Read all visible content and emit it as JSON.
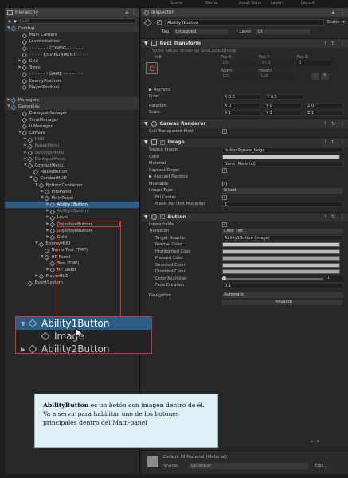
{
  "window_tabs": [
    "Scene",
    "Game",
    "Asset Store",
    "Layers",
    "Layout"
  ],
  "hierarchy": {
    "tab_label": "Hierarchy",
    "search_placeholder": "All",
    "rows": [
      {
        "label": "Combat",
        "indent": 0,
        "arrow": "▼",
        "style": "scene",
        "icon": "scene"
      },
      {
        "label": "Main Camera",
        "indent": 2,
        "arrow": "",
        "style": "",
        "icon": "cube"
      },
      {
        "label": "LevelInitializer",
        "indent": 2,
        "arrow": "",
        "style": "",
        "icon": "cube"
      },
      {
        "label": "- - - - - - - CONFIG - - - - - -",
        "indent": 2,
        "arrow": "",
        "style": "",
        "icon": "cube"
      },
      {
        "label": "- - - - - ENVIRONMENT - - - -",
        "indent": 2,
        "arrow": "",
        "style": "",
        "icon": "cube"
      },
      {
        "label": "Grid",
        "indent": 2,
        "arrow": "▶",
        "style": "",
        "icon": "cube"
      },
      {
        "label": "Trees",
        "indent": 2,
        "arrow": "▶",
        "style": "",
        "icon": "cube"
      },
      {
        "label": "- - - - - - - GAME - - - - - - -",
        "indent": 2,
        "arrow": "",
        "style": "",
        "icon": "cube"
      },
      {
        "label": "EnemyPosition",
        "indent": 2,
        "arrow": "",
        "style": "",
        "icon": "cube"
      },
      {
        "label": "PlayerPosition",
        "indent": 2,
        "arrow": "",
        "style": "",
        "icon": "cube"
      },
      {
        "label": "",
        "indent": 0,
        "arrow": "",
        "style": "",
        "icon": ""
      },
      {
        "label": "Managers",
        "indent": 0,
        "arrow": "▶",
        "style": "scene",
        "icon": "scene"
      },
      {
        "label": "Gameplay",
        "indent": 0,
        "arrow": "▼",
        "style": "scene",
        "icon": "scene"
      },
      {
        "label": "DialogueManager",
        "indent": 2,
        "arrow": "",
        "style": "",
        "icon": "cube"
      },
      {
        "label": "TimeManager",
        "indent": 2,
        "arrow": "",
        "style": "",
        "icon": "cube"
      },
      {
        "label": "UIManager",
        "indent": 2,
        "arrow": "",
        "style": "",
        "icon": "cube"
      },
      {
        "label": "Canvas",
        "indent": 2,
        "arrow": "▼",
        "style": "",
        "icon": "cube"
      },
      {
        "label": "HUD",
        "indent": 3,
        "arrow": "▶",
        "style": "dim",
        "icon": "cube"
      },
      {
        "label": "PauseMenu",
        "indent": 3,
        "arrow": "▶",
        "style": "dim",
        "icon": "cube"
      },
      {
        "label": "SettingsMenu",
        "indent": 3,
        "arrow": "▶",
        "style": "dim",
        "icon": "cube"
      },
      {
        "label": "DialogueMenu",
        "indent": 3,
        "arrow": "▶",
        "style": "dim",
        "icon": "cube"
      },
      {
        "label": "CombatMenu",
        "indent": 3,
        "arrow": "▼",
        "style": "",
        "icon": "cube"
      },
      {
        "label": "PauseButton",
        "indent": 4,
        "arrow": "",
        "style": "",
        "icon": "cube"
      },
      {
        "label": "CombatHUD",
        "indent": 4,
        "arrow": "▼",
        "style": "",
        "icon": "cube"
      },
      {
        "label": "BottomContainer",
        "indent": 5,
        "arrow": "▼",
        "style": "",
        "icon": "cube"
      },
      {
        "label": "InfoPanel",
        "indent": 6,
        "arrow": "▶",
        "style": "",
        "icon": "cube"
      },
      {
        "label": "MainPanel",
        "indent": 6,
        "arrow": "▼",
        "style": "",
        "icon": "cube"
      },
      {
        "label": "Ability1Button",
        "indent": 7,
        "arrow": "▶",
        "style": "sel",
        "icon": "cube"
      },
      {
        "label": "Ability2Button",
        "indent": 7,
        "arrow": "▶",
        "style": "dim",
        "icon": "cube"
      },
      {
        "label": "Level",
        "indent": 7,
        "arrow": "▶",
        "style": "",
        "icon": "cube"
      },
      {
        "label": "ObjectiveButton",
        "indent": 7,
        "arrow": "▶",
        "style": "",
        "icon": "cube"
      },
      {
        "label": "ObjectiveButton",
        "indent": 7,
        "arrow": "▶",
        "style": "",
        "icon": "cube"
      },
      {
        "label": "Gold",
        "indent": 7,
        "arrow": "▶",
        "style": "",
        "icon": "cube"
      },
      {
        "label": "EnemyHUD",
        "indent": 5,
        "arrow": "▼",
        "style": "",
        "icon": "cube"
      },
      {
        "label": "Name Text (TMP)",
        "indent": 6,
        "arrow": "",
        "style": "",
        "icon": "cube"
      },
      {
        "label": "HP Panel",
        "indent": 6,
        "arrow": "▼",
        "style": "",
        "icon": "cube"
      },
      {
        "label": "Text (TMP)",
        "indent": 7,
        "arrow": "",
        "style": "",
        "icon": "cube"
      },
      {
        "label": "HP Slider",
        "indent": 7,
        "arrow": "▶",
        "style": "",
        "icon": "cube"
      },
      {
        "label": "PlayerHUD",
        "indent": 5,
        "arrow": "▶",
        "style": "",
        "icon": "cube"
      },
      {
        "label": "EventSystem",
        "indent": 3,
        "arrow": "",
        "style": "",
        "icon": "cube"
      }
    ]
  },
  "zoom": {
    "rows": [
      {
        "label": "Ability1Button",
        "arrow": "▼",
        "style": "sel",
        "indent": 0
      },
      {
        "label": "Image",
        "arrow": "",
        "style": "",
        "indent": 1
      },
      {
        "label": "Ability2Button",
        "arrow": "▶",
        "style": "",
        "indent": 0
      }
    ]
  },
  "inspector": {
    "tab_label": "Inspector",
    "object_name": "Ability1Button",
    "static_label": "Static",
    "tag_label": "Tag",
    "tag_value": "Untagged",
    "layer_label": "Layer",
    "layer_value": "UI",
    "rect_transform": {
      "title": "Rect Transform",
      "note": "Some values driven by GridLayoutGroup.",
      "anchor_label": "left",
      "pos_x_label": "Pos X",
      "pos_y_label": "Pos Y",
      "pos_z_label": "Pos Z",
      "pos_x": "100",
      "pos_y": "-97.5",
      "pos_z": "0",
      "width_label": "Width",
      "height_label": "Height",
      "width": "100",
      "height": "125",
      "anchors_label": "Anchors",
      "pivot_label": "Pivot",
      "pivot_x": "X 0.5",
      "pivot_y": "Y 0.5",
      "rotation_label": "Rotation",
      "rot_x": "X 0",
      "rot_y": "Y 0",
      "rot_z": "Z 0",
      "scale_label": "Scale",
      "scale_x": "X 1",
      "scale_y": "Y 1",
      "scale_z": "Z 1"
    },
    "canvas_renderer": {
      "title": "Canvas Renderer",
      "cull_label": "Cull Transparent Mesh",
      "cull_value": "✓"
    },
    "image": {
      "title": "Image",
      "source_label": "Source Image",
      "source_value": "buttonSquare_beige",
      "color_label": "Color",
      "material_label": "Material",
      "material_value": "None (Material)",
      "raycast_target_label": "Raycast Target",
      "raycast_padding_label": "Raycast Padding",
      "maskable_label": "Maskable",
      "image_type_label": "Image Type",
      "image_type_value": "Sliced",
      "fill_center_label": "Fill Center",
      "ppu_label": "Pixels Per Unit Multiplier",
      "ppu_value": "1"
    },
    "button": {
      "title": "Button",
      "interactable_label": "Interactable",
      "transition_label": "Transition",
      "transition_value": "Color Tint",
      "target_label": "Target Graphic",
      "target_value": "Ability1Button (Image)",
      "normal_label": "Normal Color",
      "highlighted_label": "Highlighted Color",
      "pressed_label": "Pressed Color",
      "selected_label": "Selected Color",
      "disabled_label": "Disabled Color",
      "multiplier_label": "Color Multiplier",
      "multiplier_value": "1",
      "fade_label": "Fade Duration",
      "fade_value": "0.1",
      "navigation_label": "Navigation",
      "navigation_value": "Automatic",
      "visualize_label": "Visualize"
    },
    "material_footer": {
      "name": "Default UI Material (Material)",
      "shader_label": "Shader",
      "shader_value": "UI/Default",
      "edit_label": "Edit..."
    }
  },
  "note": {
    "bold": "AbilityButton",
    "text": " es un botón con imagen dentro de él. Va a servir para habilitar uno de los botones principales dentro del Main-panel"
  },
  "colors": {
    "selection": "#2c5d87",
    "highlight_border": "#d33333",
    "note_bg": "#dff0f6"
  }
}
